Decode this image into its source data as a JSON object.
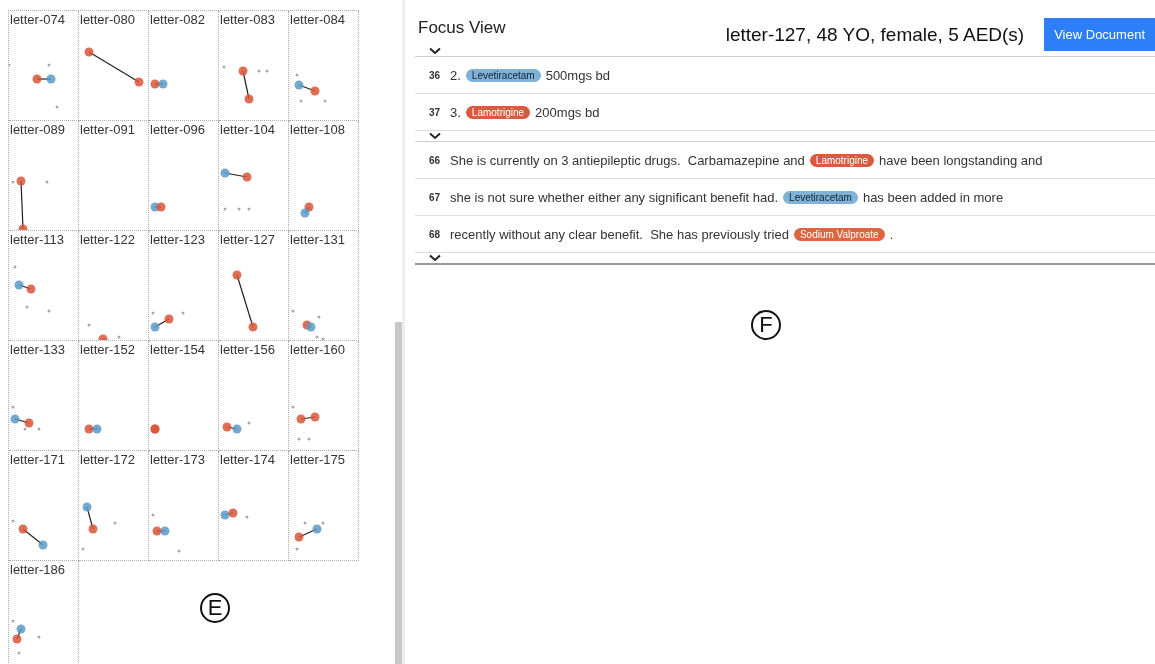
{
  "overview": {
    "plots": [
      {
        "title": "letter-074"
      },
      {
        "title": "letter-080"
      },
      {
        "title": "letter-082"
      },
      {
        "title": "letter-083"
      },
      {
        "title": "letter-084"
      },
      {
        "title": "letter-089"
      },
      {
        "title": "letter-091"
      },
      {
        "title": "letter-096"
      },
      {
        "title": "letter-104"
      },
      {
        "title": "letter-108"
      },
      {
        "title": "letter-113"
      },
      {
        "title": "letter-122"
      },
      {
        "title": "letter-123"
      },
      {
        "title": "letter-127"
      },
      {
        "title": "letter-131"
      },
      {
        "title": "letter-133"
      },
      {
        "title": "letter-152"
      },
      {
        "title": "letter-154"
      },
      {
        "title": "letter-156"
      },
      {
        "title": "letter-160"
      },
      {
        "title": "letter-171"
      },
      {
        "title": "letter-172"
      },
      {
        "title": "letter-173"
      },
      {
        "title": "letter-174"
      },
      {
        "title": "letter-175"
      },
      {
        "title": "letter-186"
      }
    ],
    "marker": "E"
  },
  "focus_view": {
    "title": "Focus View",
    "patient": "letter-127, 48 YO, female, 5 AED(s)",
    "button": "View Document",
    "marker": "F",
    "groups": [
      {
        "lines": [
          {
            "number": "36",
            "segments": [
              {
                "kind": "text",
                "text": "2."
              },
              {
                "kind": "tag",
                "text": "Levetiracetam",
                "color": "#7fb2d6"
              },
              {
                "kind": "text",
                "text": "500mgs bd"
              }
            ]
          },
          {
            "number": "37",
            "segments": [
              {
                "kind": "text",
                "text": "3."
              },
              {
                "kind": "tag",
                "text": "Lamotrigine",
                "color": "#d95a3f"
              },
              {
                "kind": "text",
                "text": "200mgs bd"
              }
            ]
          }
        ]
      },
      {
        "lines": [
          {
            "number": "66",
            "segments": [
              {
                "kind": "text",
                "text": "She is currently on 3 antiepileptic drugs.  Carbamazepine and"
              },
              {
                "kind": "tag",
                "text": "Lamotrigine",
                "color": "#d95a3f"
              },
              {
                "kind": "text",
                "text": "have been longstanding and"
              }
            ]
          },
          {
            "number": "67",
            "segments": [
              {
                "kind": "text",
                "text": "she is not sure whether either any significant benefit had."
              },
              {
                "kind": "tag",
                "text": "Levetiracetam",
                "color": "#7fb2d6"
              },
              {
                "kind": "text",
                "text": "has been added in more"
              }
            ]
          },
          {
            "number": "68",
            "segments": [
              {
                "kind": "text",
                "text": "recently without any clear benefit.  She has previously tried"
              },
              {
                "kind": "tag",
                "text": "Sodium Valproate",
                "color": "#e0643f"
              },
              {
                "kind": "text",
                "text": "."
              }
            ]
          }
        ]
      }
    ]
  }
}
